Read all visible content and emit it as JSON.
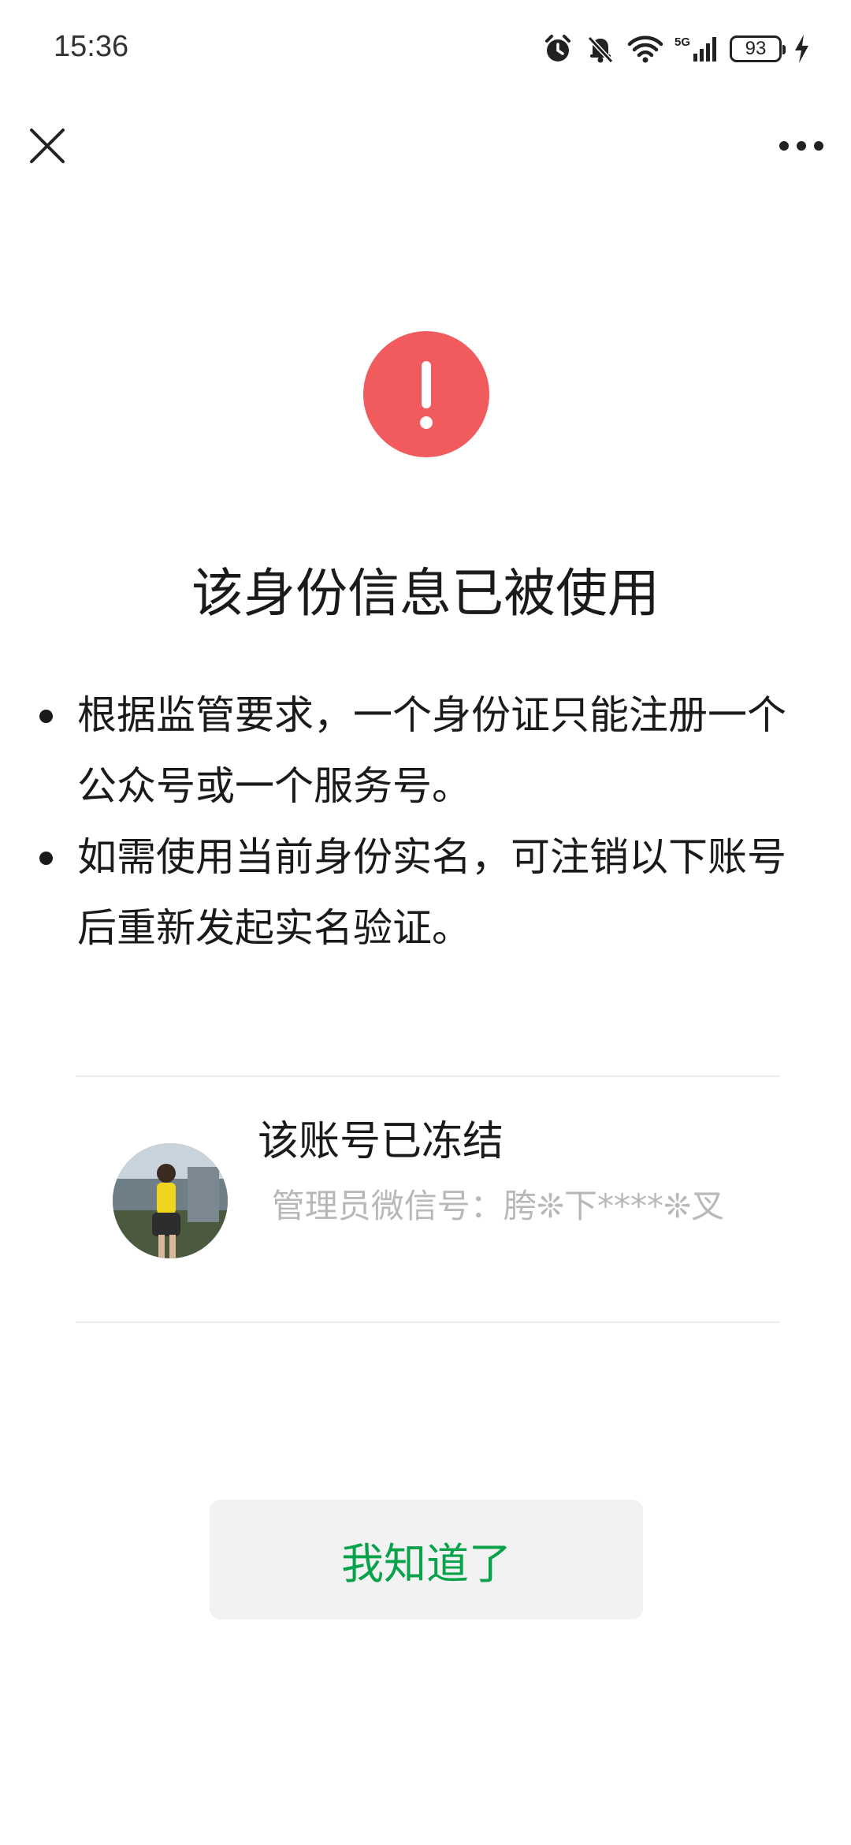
{
  "status_bar": {
    "time": "15:36",
    "network": "5G",
    "battery": "93",
    "icons": [
      "alarm-icon",
      "mute-bell-icon",
      "wifi-icon",
      "signal-icon",
      "battery-icon",
      "charging-icon"
    ]
  },
  "nav": {
    "close_icon": "close-icon",
    "more_icon": "more-icon"
  },
  "warning": {
    "icon": "exclamation-icon",
    "color": "#f15b5e"
  },
  "title": "该身份信息已被使用",
  "bullets": [
    {
      "text": "根据监管要求，一个身份证只能注册一个公众号或一个服务号。"
    },
    {
      "text": "如需使用当前身份实名，可注销以下账号后重新发起实名验证。"
    }
  ],
  "account": {
    "status": "该账号已冻结",
    "admin_label": "管理员微信号：",
    "admin_value": "胯❊下****❊叉"
  },
  "button": {
    "label": "我知道了",
    "color": "#07a24a"
  }
}
